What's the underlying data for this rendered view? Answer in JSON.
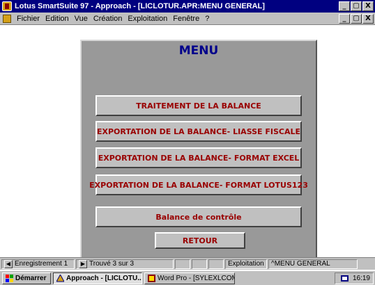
{
  "window": {
    "title": "Lotus SmartSuite 97  - Approach - [LICLOTUR.APR:MENU GENERAL]",
    "buttons": {
      "minimize": "_",
      "restore": " 8",
      "close": "X"
    }
  },
  "menubar": {
    "items": [
      "Fichier",
      "Edition",
      "Vue",
      "Création",
      "Exploitation",
      "Fenêtre",
      "?"
    ],
    "buttons": {
      "minimize": "_",
      "restore": " 8",
      "close": "X"
    }
  },
  "panel": {
    "title": "MENU",
    "buttons": [
      "TRAITEMENT DE LA BALANCE",
      "EXPORTATION DE LA BALANCE- LIASSE FISCALE",
      "EXPORTATION DE LA BALANCE- FORMAT EXCEL",
      "EXPORTATION DE LA BALANCE- FORMAT LOTUS123",
      "Balance de contrôle",
      "RETOUR"
    ]
  },
  "statusbar": {
    "record": "Enregistrement 1",
    "found": "Trouvé 3 sur 3",
    "mode": "Exploitation",
    "view": "^MENU GENERAL"
  },
  "taskbar": {
    "start": "Démarrer",
    "tasks": [
      "Approach - [LICLOTU...",
      "Word Pro - [SYLEXLCOM..."
    ],
    "clock": "16:19"
  },
  "colors": {
    "titlebar": "#000080",
    "panel": "#999999",
    "button_text": "#990000",
    "menu_title": "#00008b"
  }
}
